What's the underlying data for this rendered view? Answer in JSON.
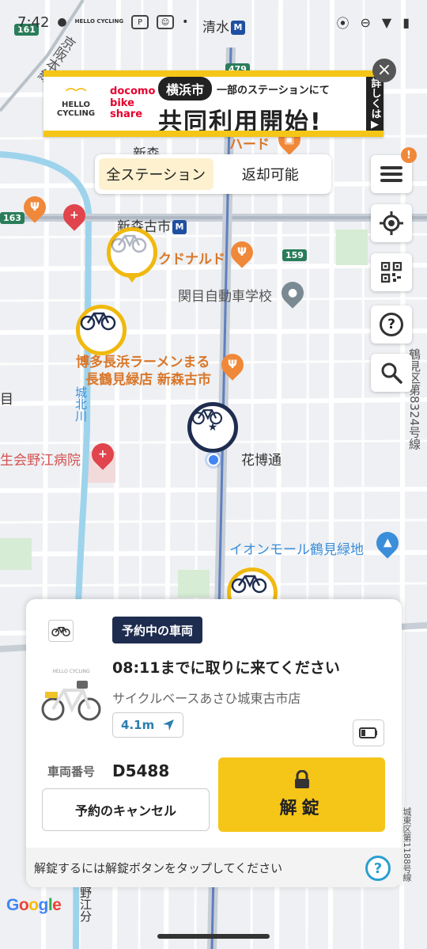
{
  "status_bar": {
    "time": "7:42",
    "carrier_icon_text": "HELLO CYCLING",
    "battery_icon": "battery-icon",
    "wifi_icon": "wifi-icon",
    "location_icon": "location-icon",
    "dnd_icon": "dnd-icon"
  },
  "map": {
    "labels": {
      "shimizu": "清水",
      "shinmori": "新森",
      "shinmori_furuichi": "新森古市",
      "mcdonalds": "クドナルド",
      "kanto_driving": "関目自動車学校",
      "hakata_ramen_1": "博多長浜ラーメンまる",
      "hakata_ramen_2": "長鶴見緑店 新森古市",
      "hanahaku": "花博通",
      "nozue_hospital": "生会野江病院",
      "aeon": "イオンモール鶴見緑地",
      "ward_road": "鶴見区第8324号線",
      "ward_road_2": "城東区第1188号線",
      "kyobashi": "京阪本線",
      "shirokita": "城北川",
      "noe": "野江分",
      "sekime": "目",
      "hard": "ハード",
      "route_159": "159",
      "route_161": "161",
      "route_163": "163",
      "route_479": "479"
    }
  },
  "ad_banner": {
    "brand_hello": "HELLO CYCLING",
    "brand_docomo_1": "docomo",
    "brand_docomo_2": "bike share",
    "city": "横浜市",
    "subline": "一部のステーションにて",
    "headline": "共同利用開始!",
    "detail": "詳しくは▶",
    "close": "×"
  },
  "filter": {
    "all_stations": "全ステーション",
    "returnable": "返却可能",
    "active": "all_stations"
  },
  "controls": {
    "menu_badge": "!",
    "help_glyph": "?"
  },
  "reservation_card": {
    "status": "予約中の車両",
    "pickup_deadline": "08:11までに取りに来てください",
    "station_name": "サイクルベースあさひ城東古市店",
    "distance": "4.1m",
    "vehicle_label": "車両番号",
    "vehicle_id": "D5488",
    "cancel_label": "予約のキャンセル",
    "unlock_label": "解錠",
    "hint": "解錠するには解錠ボタンをタップしてください",
    "help_glyph": "?",
    "bike_photo_brand": "HELLO CYCLING"
  },
  "footer": {
    "google": [
      "G",
      "o",
      "o",
      "g",
      "l",
      "e"
    ]
  },
  "colors": {
    "brand_yellow": "#f5c518",
    "navy": "#1e2d4f",
    "accent_orange": "#f0883a",
    "link_blue": "#2a9fd0"
  }
}
